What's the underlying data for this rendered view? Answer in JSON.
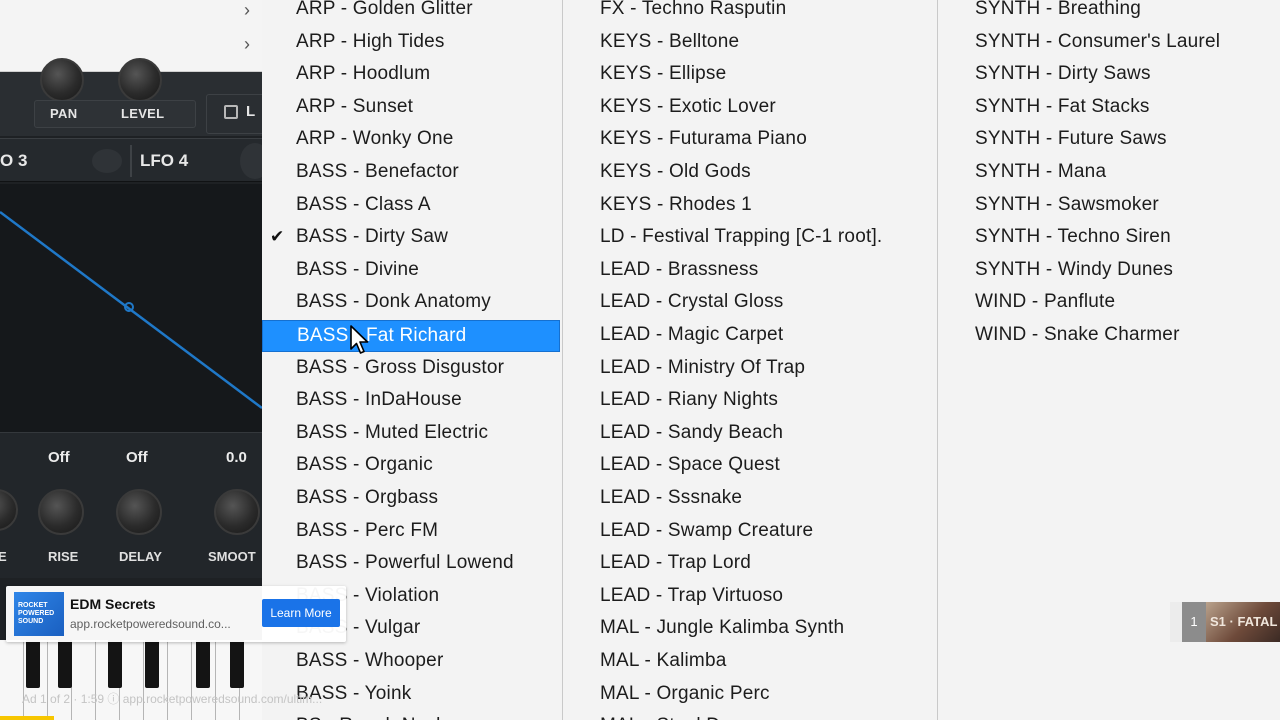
{
  "synth": {
    "knobs_top": [
      {
        "label": "PAN"
      },
      {
        "label": "LEVEL"
      }
    ],
    "toggle_label": "L",
    "lfo_tabs": [
      {
        "label": "O 3"
      },
      {
        "label": "LFO 4"
      }
    ],
    "envelope": [
      {
        "value": "Off",
        "label": "RISE"
      },
      {
        "value": "Off",
        "label": "DELAY"
      },
      {
        "value": "0.0",
        "label": "SMOOT"
      }
    ],
    "envelope_left_label": "E",
    "colors": {
      "panel": "#1e2124",
      "accent_line": "#1f78c8"
    }
  },
  "menu": {
    "columns": [
      {
        "items": [
          {
            "label": "ARP - Golden Glitter",
            "checked": false,
            "selected": false
          },
          {
            "label": "ARP - High Tides",
            "checked": false,
            "selected": false
          },
          {
            "label": "ARP - Hoodlum",
            "checked": false,
            "selected": false
          },
          {
            "label": "ARP - Sunset",
            "checked": false,
            "selected": false
          },
          {
            "label": "ARP - Wonky One",
            "checked": false,
            "selected": false
          },
          {
            "label": "BASS - Benefactor",
            "checked": false,
            "selected": false
          },
          {
            "label": "BASS - Class A",
            "checked": false,
            "selected": false
          },
          {
            "label": "BASS - Dirty Saw",
            "checked": true,
            "selected": false
          },
          {
            "label": "BASS - Divine",
            "checked": false,
            "selected": false
          },
          {
            "label": "BASS - Donk Anatomy",
            "checked": false,
            "selected": false
          },
          {
            "label": "BASS - Fat Richard",
            "checked": false,
            "selected": true
          },
          {
            "label": "BASS - Gross Disgustor",
            "checked": false,
            "selected": false
          },
          {
            "label": "BASS - InDaHouse",
            "checked": false,
            "selected": false
          },
          {
            "label": "BASS - Muted Electric",
            "checked": false,
            "selected": false
          },
          {
            "label": "BASS - Organic",
            "checked": false,
            "selected": false
          },
          {
            "label": "BASS - Orgbass",
            "checked": false,
            "selected": false
          },
          {
            "label": "BASS - Perc FM",
            "checked": false,
            "selected": false
          },
          {
            "label": "BASS - Powerful Lowend",
            "checked": false,
            "selected": false
          },
          {
            "label": "BASS - Violation",
            "checked": false,
            "selected": false
          },
          {
            "label": "BASS - Vulgar",
            "checked": false,
            "selected": false
          },
          {
            "label": "BASS - Whooper",
            "checked": false,
            "selected": false
          },
          {
            "label": "BASS - Yoink",
            "checked": false,
            "selected": false
          },
          {
            "label": "BS - Rough Neck",
            "checked": false,
            "selected": false
          }
        ]
      },
      {
        "items": [
          {
            "label": "FX - Techno Rasputin",
            "checked": false,
            "selected": false
          },
          {
            "label": "KEYS - Belltone",
            "checked": false,
            "selected": false
          },
          {
            "label": "KEYS - Ellipse",
            "checked": false,
            "selected": false
          },
          {
            "label": "KEYS - Exotic Lover",
            "checked": false,
            "selected": false
          },
          {
            "label": "KEYS - Futurama Piano",
            "checked": false,
            "selected": false
          },
          {
            "label": "KEYS - Old Gods",
            "checked": false,
            "selected": false
          },
          {
            "label": "KEYS - Rhodes 1",
            "checked": false,
            "selected": false
          },
          {
            "label": "LD - Festival Trapping [C-1 root].",
            "checked": false,
            "selected": false
          },
          {
            "label": "LEAD - Brassness",
            "checked": false,
            "selected": false
          },
          {
            "label": "LEAD - Crystal Gloss",
            "checked": false,
            "selected": false
          },
          {
            "label": "LEAD - Magic Carpet",
            "checked": false,
            "selected": false
          },
          {
            "label": "LEAD - Ministry Of Trap",
            "checked": false,
            "selected": false
          },
          {
            "label": "LEAD - Riany Nights",
            "checked": false,
            "selected": false
          },
          {
            "label": "LEAD - Sandy Beach",
            "checked": false,
            "selected": false
          },
          {
            "label": "LEAD - Space Quest",
            "checked": false,
            "selected": false
          },
          {
            "label": "LEAD - Sssnake",
            "checked": false,
            "selected": false
          },
          {
            "label": "LEAD - Swamp Creature",
            "checked": false,
            "selected": false
          },
          {
            "label": "LEAD - Trap Lord",
            "checked": false,
            "selected": false
          },
          {
            "label": "LEAD - Trap Virtuoso",
            "checked": false,
            "selected": false
          },
          {
            "label": "MAL - Jungle Kalimba Synth",
            "checked": false,
            "selected": false
          },
          {
            "label": "MAL - Kalimba",
            "checked": false,
            "selected": false
          },
          {
            "label": "MAL - Organic Perc",
            "checked": false,
            "selected": false
          },
          {
            "label": "MAL - Steel Drum",
            "checked": false,
            "selected": false
          }
        ]
      },
      {
        "items": [
          {
            "label": "SYNTH - Breathing",
            "checked": false,
            "selected": false
          },
          {
            "label": "SYNTH - Consumer's Laurel",
            "checked": false,
            "selected": false
          },
          {
            "label": "SYNTH - Dirty Saws",
            "checked": false,
            "selected": false
          },
          {
            "label": "SYNTH - Fat Stacks",
            "checked": false,
            "selected": false
          },
          {
            "label": "SYNTH - Future Saws",
            "checked": false,
            "selected": false
          },
          {
            "label": "SYNTH - Mana",
            "checked": false,
            "selected": false
          },
          {
            "label": "SYNTH - Sawsmoker",
            "checked": false,
            "selected": false
          },
          {
            "label": "SYNTH - Techno Siren",
            "checked": false,
            "selected": false
          },
          {
            "label": "SYNTH - Windy Dunes",
            "checked": false,
            "selected": false
          },
          {
            "label": "WIND - Panflute",
            "checked": false,
            "selected": false
          },
          {
            "label": "WIND - Snake Charmer",
            "checked": false,
            "selected": false
          }
        ]
      }
    ],
    "colors": {
      "background": "#f3f3f3",
      "selected": "#1e90ff",
      "text": "#1c1c1c"
    }
  },
  "ad": {
    "logo_text": "ROCKET POWERED SOUND",
    "title": "EDM Secrets",
    "url": "app.rocketpoweredsound.co...",
    "button": "Learn More",
    "info": "Ad 1 of 2 · 1:59 ⓘ  app.rocketpoweredsound.com/ultim...",
    "colors": {
      "button": "#1a73e8",
      "progress": "#f7c600"
    }
  },
  "thumbnail": {
    "badge": "1",
    "text": "S1 · FATAL"
  }
}
